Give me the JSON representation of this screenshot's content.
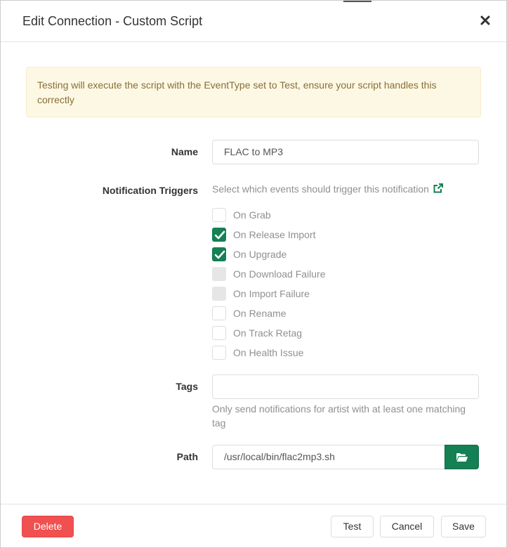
{
  "modal": {
    "title": "Edit Connection - Custom Script"
  },
  "alert": {
    "text": "Testing will execute the script with the EventType set to Test, ensure your script handles this correctly"
  },
  "form": {
    "name": {
      "label": "Name",
      "value": "FLAC to MP3"
    },
    "triggers": {
      "label": "Notification Triggers",
      "help": "Select which events should trigger this notification",
      "items": [
        {
          "label": "On Grab",
          "checked": false,
          "disabled": false
        },
        {
          "label": "On Release Import",
          "checked": true,
          "disabled": false
        },
        {
          "label": "On Upgrade",
          "checked": true,
          "disabled": false
        },
        {
          "label": "On Download Failure",
          "checked": false,
          "disabled": true
        },
        {
          "label": "On Import Failure",
          "checked": false,
          "disabled": true
        },
        {
          "label": "On Rename",
          "checked": false,
          "disabled": false
        },
        {
          "label": "On Track Retag",
          "checked": false,
          "disabled": false
        },
        {
          "label": "On Health Issue",
          "checked": false,
          "disabled": false
        }
      ]
    },
    "tags": {
      "label": "Tags",
      "value": "",
      "help": "Only send notifications for artist with at least one matching tag"
    },
    "path": {
      "label": "Path",
      "value": "/usr/local/bin/flac2mp3.sh"
    }
  },
  "footer": {
    "delete_label": "Delete",
    "test_label": "Test",
    "cancel_label": "Cancel",
    "save_label": "Save"
  },
  "colors": {
    "primary_green": "#148053",
    "danger_red": "#f05050",
    "alert_bg": "#fcf8e3",
    "alert_text": "#8a6d3b",
    "muted_text": "#909090"
  },
  "icons": {
    "close": "close-icon",
    "external_link": "external-link-icon",
    "folder_open": "folder-open-icon",
    "check": "check-icon"
  }
}
